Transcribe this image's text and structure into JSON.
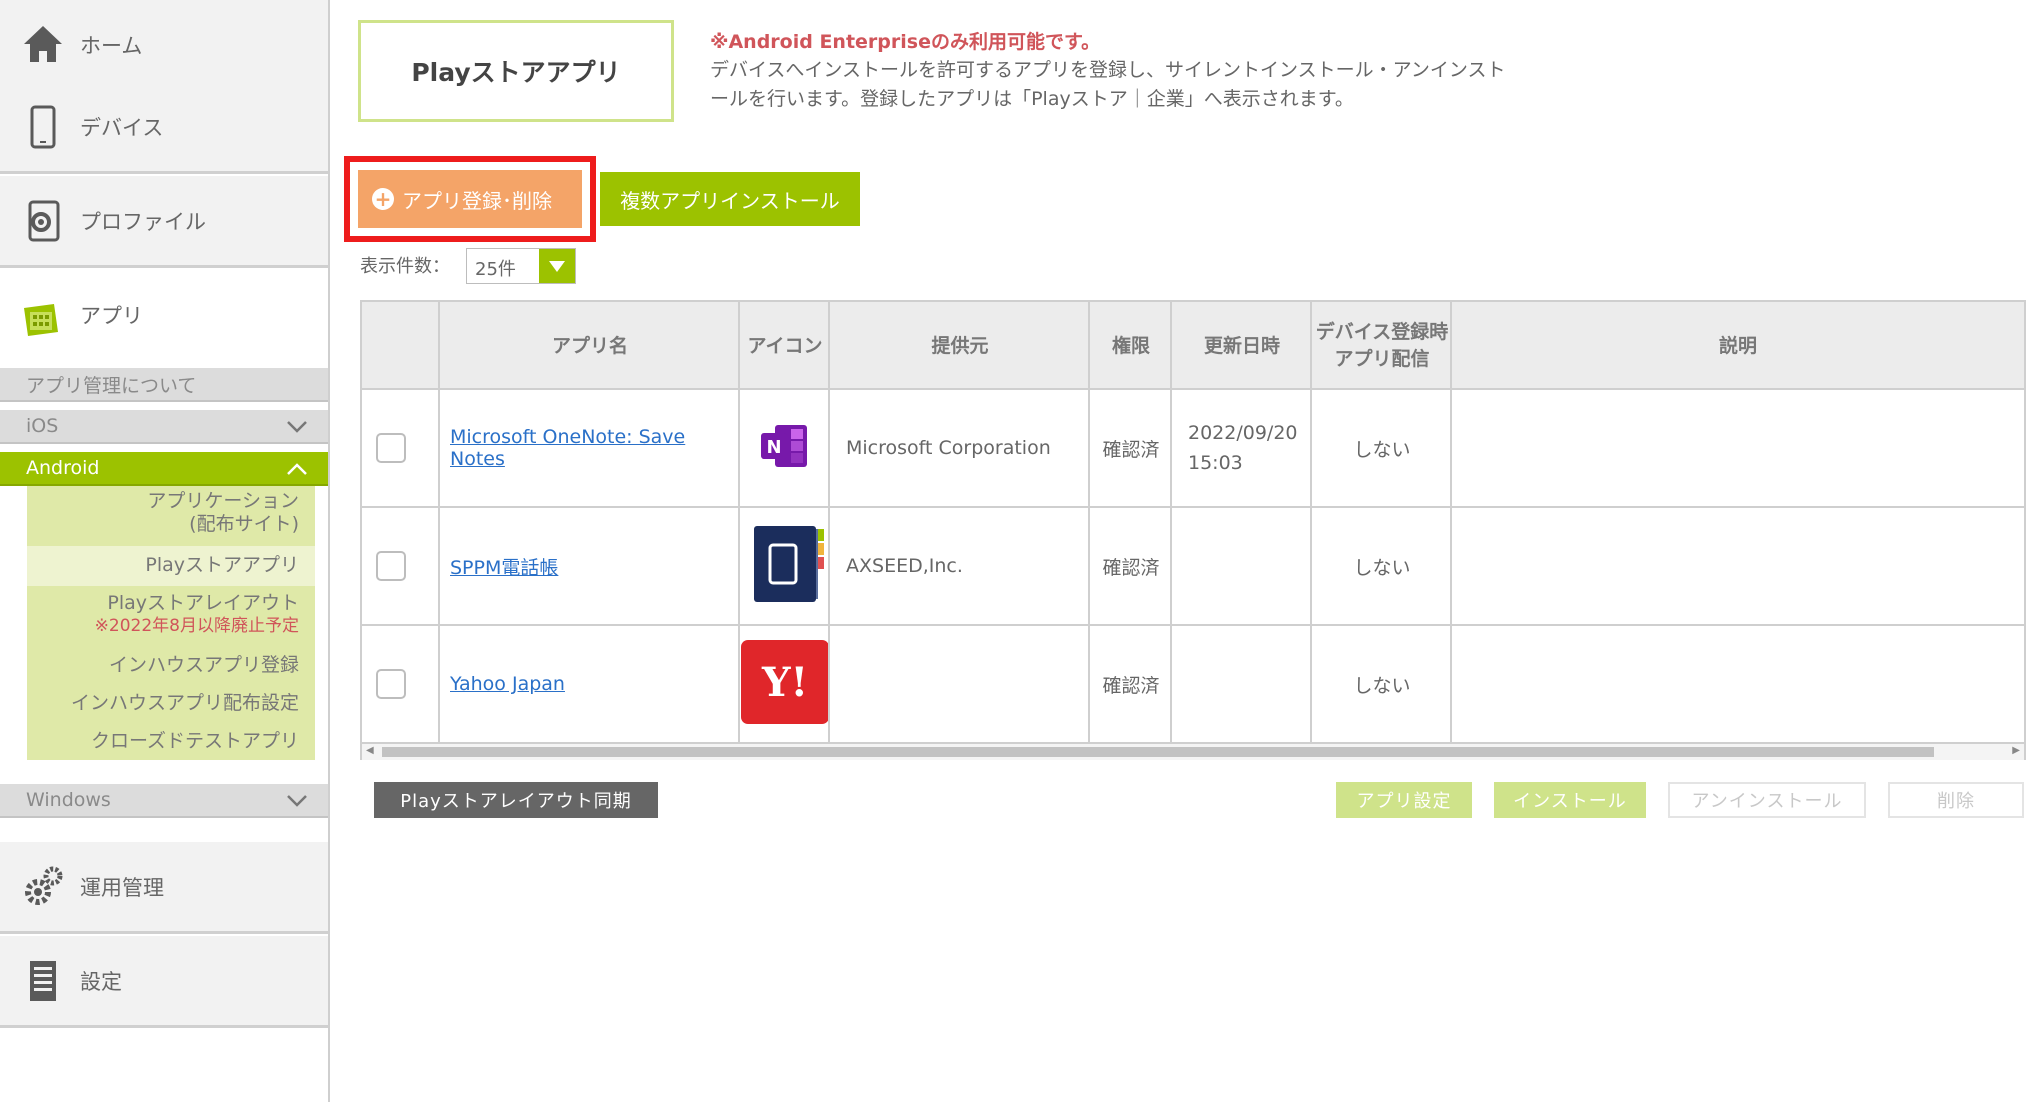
{
  "sidebar": {
    "home": {
      "label": "ホーム",
      "icon": "home-icon"
    },
    "device": {
      "label": "デバイス",
      "icon": "smartphone-icon"
    },
    "profile": {
      "label": "プロファイル",
      "icon": "profile-gear-icon"
    },
    "app": {
      "label": "アプリ",
      "icon": "app-grid-icon"
    },
    "about": {
      "label": "アプリ管理について"
    },
    "ios": {
      "label": "iOS"
    },
    "android": {
      "label": "Android",
      "items": [
        {
          "line1": "アプリケーション",
          "line2": "(配布サイト)"
        },
        {
          "label": "Playストアアプリ"
        },
        {
          "line1": "Playストアレイアウト",
          "warn": "※2022年8月以降廃止予定"
        },
        {
          "label": "インハウスアプリ登録"
        },
        {
          "label": "インハウスアプリ配布設定"
        },
        {
          "label": "クローズドテストアプリ"
        }
      ]
    },
    "windows": {
      "label": "Windows"
    },
    "operation": {
      "label": "運用管理",
      "icon": "gears-icon"
    },
    "settings": {
      "label": "設定",
      "icon": "document-list-icon"
    }
  },
  "page": {
    "title": "Playストアアプリ",
    "notice_title": "※Android Enterpriseのみ利用可能です。",
    "notice_line1": "デバイスへインストールを許可するアプリを登録し、サイレントインストール・アンインスト",
    "notice_line2": "ールを行います。登録したアプリは「Playストア｜企業」へ表示されます。"
  },
  "toolbar": {
    "register_label": "アプリ登録･削除",
    "multi_install_label": "複数アプリインストール",
    "per_page_label": "表示件数：",
    "per_page_value": "25件"
  },
  "table": {
    "headers": {
      "name": "アプリ名",
      "icon": "アイコン",
      "provider": "提供元",
      "permission": "権限",
      "updated": "更新日時",
      "device_reg_line1": "デバイス登録時",
      "device_reg_line2": "アプリ配信",
      "description": "説明"
    },
    "rows": [
      {
        "name": "Microsoft OneNote: Save Notes",
        "icon": "onenote-icon",
        "provider": "Microsoft Corporation",
        "permission": "確認済",
        "updated_date": "2022/09/20",
        "updated_time": "15:03",
        "device_reg": "しない",
        "description": ""
      },
      {
        "name": "SPPM電話帳",
        "icon": "sppm-phonebook-icon",
        "provider": "AXSEED,Inc.",
        "permission": "確認済",
        "updated_date": "",
        "updated_time": "",
        "device_reg": "しない",
        "description": ""
      },
      {
        "name": "Yahoo Japan",
        "icon": "yahoo-icon",
        "provider": "",
        "permission": "確認済",
        "updated_date": "",
        "updated_time": "",
        "device_reg": "しない",
        "description": ""
      }
    ]
  },
  "buttons": {
    "sync": "Playストアレイアウト同期",
    "app_settings": "アプリ設定",
    "install": "インストール",
    "uninstall": "アンインストール",
    "delete": "削除"
  },
  "colors": {
    "accent_green": "#9cc200",
    "register_orange": "#f4a468",
    "highlight_red": "#ee1c1c",
    "notice_red": "#d0555a",
    "link_blue": "#2a70c8"
  }
}
